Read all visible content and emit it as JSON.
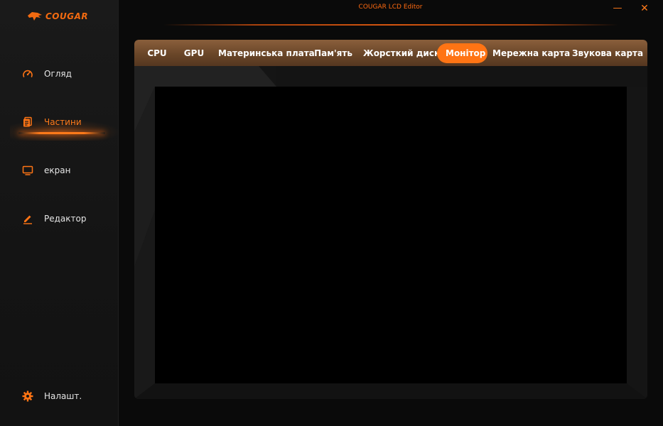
{
  "window": {
    "title": "COUGAR LCD Editor",
    "minimize_glyph": "—",
    "close_glyph": "✕"
  },
  "brand": {
    "logo_text": "COUGAR",
    "accent_color": "#ff7414"
  },
  "sidebar": {
    "items": [
      {
        "label": "Огляд",
        "icon": "speedometer-icon",
        "active": false
      },
      {
        "label": "Частини",
        "icon": "parts-icon",
        "active": true
      },
      {
        "label": "екран",
        "icon": "monitor-icon",
        "active": false
      },
      {
        "label": "Редактор",
        "icon": "pen-icon",
        "active": false
      }
    ],
    "settings": {
      "label": "Налашт.",
      "icon": "gear-icon"
    }
  },
  "tabs": [
    {
      "label": "CPU",
      "active": false
    },
    {
      "label": "GPU",
      "active": false
    },
    {
      "label": "Материнська плата",
      "active": false
    },
    {
      "label": "Пам'ять",
      "active": false
    },
    {
      "label": "Жорсткий диск",
      "active": false
    },
    {
      "label": "Монітор",
      "active": true
    },
    {
      "label": "Мережна карта",
      "active": false
    },
    {
      "label": "Звукова карта",
      "active": false
    }
  ]
}
